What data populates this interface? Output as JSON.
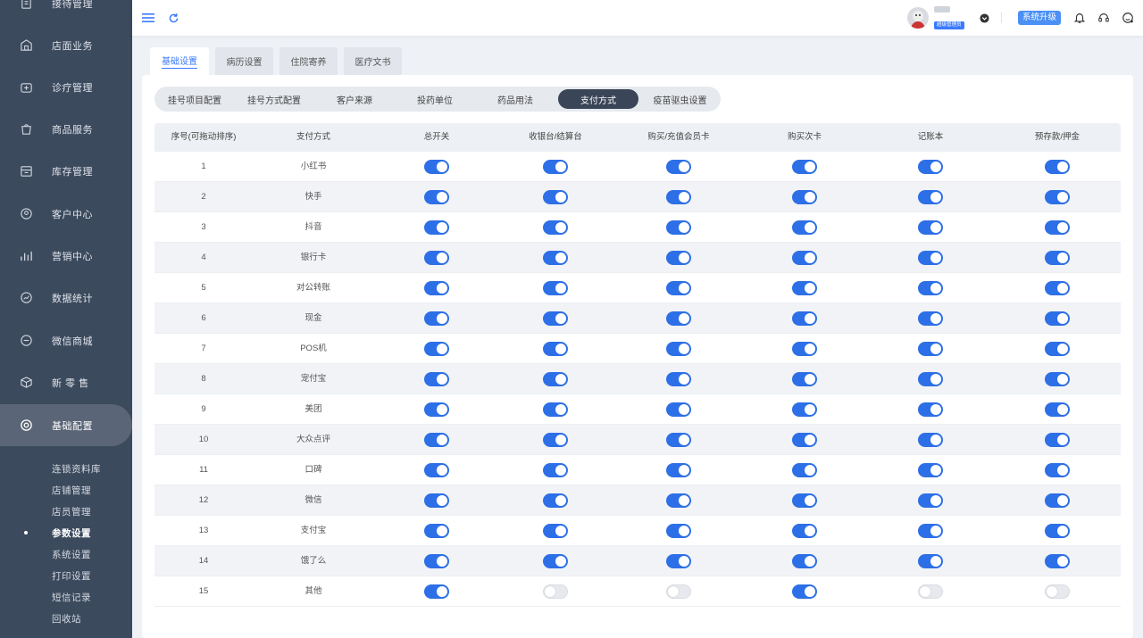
{
  "sidebar": {
    "items": [
      {
        "label": "接待管理",
        "icon": "reception-icon"
      },
      {
        "label": "店面业务",
        "icon": "store-icon"
      },
      {
        "label": "诊疗管理",
        "icon": "medical-kit-icon"
      },
      {
        "label": "商品服务",
        "icon": "shopping-bag-icon"
      },
      {
        "label": "库存管理",
        "icon": "inventory-box-icon"
      },
      {
        "label": "客户中心",
        "icon": "customer-icon"
      },
      {
        "label": "营销中心",
        "icon": "marketing-chart-icon"
      },
      {
        "label": "数据统计",
        "icon": "statistics-icon"
      },
      {
        "label": "微信商城",
        "icon": "wechat-mall-icon"
      },
      {
        "label": "新 零 售",
        "icon": "retail-cube-icon"
      },
      {
        "label": "基础配置",
        "icon": "settings-gear-icon"
      }
    ],
    "sub_items": [
      "连锁资料库",
      "店铺管理",
      "店员管理",
      "参数设置",
      "系统设置",
      "打印设置",
      "短信记录",
      "回收站"
    ],
    "current_sub": "参数设置"
  },
  "header": {
    "role_badge": "超级管理员",
    "upgrade_label": "系统升级",
    "icons": [
      "menu-icon",
      "refresh-icon",
      "bell-icon",
      "headset-icon",
      "support-icon"
    ]
  },
  "top_tabs": [
    "基础设置",
    "病历设置",
    "住院寄养",
    "医疗文书"
  ],
  "active_top_tab": "基础设置",
  "sub_tabs": [
    "挂号项目配置",
    "挂号方式配置",
    "客户来源",
    "投药单位",
    "药品用法",
    "支付方式",
    "疫苗驱虫设置"
  ],
  "active_sub_tab": "支付方式",
  "table": {
    "headers": [
      "序号(可拖动排序)",
      "支付方式",
      "总开关",
      "收银台/结算台",
      "购买/充值会员卡",
      "购买次卡",
      "记账本",
      "预存款/押金"
    ],
    "rows": [
      {
        "no": "1",
        "name": "小红书",
        "toggles": [
          true,
          true,
          true,
          true,
          true,
          true
        ]
      },
      {
        "no": "2",
        "name": "快手",
        "toggles": [
          true,
          true,
          true,
          true,
          true,
          true
        ]
      },
      {
        "no": "3",
        "name": "抖音",
        "toggles": [
          true,
          true,
          true,
          true,
          true,
          true
        ]
      },
      {
        "no": "4",
        "name": "银行卡",
        "toggles": [
          true,
          true,
          true,
          true,
          true,
          true
        ]
      },
      {
        "no": "5",
        "name": "对公转账",
        "toggles": [
          true,
          true,
          true,
          true,
          true,
          true
        ]
      },
      {
        "no": "6",
        "name": "现金",
        "toggles": [
          true,
          true,
          true,
          true,
          true,
          true
        ]
      },
      {
        "no": "7",
        "name": "POS机",
        "toggles": [
          true,
          true,
          true,
          true,
          true,
          true
        ]
      },
      {
        "no": "8",
        "name": "宠付宝",
        "toggles": [
          true,
          true,
          true,
          true,
          true,
          true
        ]
      },
      {
        "no": "9",
        "name": "美团",
        "toggles": [
          true,
          true,
          true,
          true,
          true,
          true
        ]
      },
      {
        "no": "10",
        "name": "大众点评",
        "toggles": [
          true,
          true,
          true,
          true,
          true,
          true
        ]
      },
      {
        "no": "11",
        "name": "口碑",
        "toggles": [
          true,
          true,
          true,
          true,
          true,
          true
        ]
      },
      {
        "no": "12",
        "name": "微信",
        "toggles": [
          true,
          true,
          true,
          true,
          true,
          true
        ]
      },
      {
        "no": "13",
        "name": "支付宝",
        "toggles": [
          true,
          true,
          true,
          true,
          true,
          true
        ]
      },
      {
        "no": "14",
        "name": "饿了么",
        "toggles": [
          true,
          true,
          true,
          true,
          true,
          true
        ]
      },
      {
        "no": "15",
        "name": "其他",
        "toggles": [
          true,
          false,
          false,
          true,
          false,
          false
        ]
      }
    ]
  },
  "colors": {
    "accent": "#2d6fe6",
    "sidebar": "#3c4a5d",
    "active_pill": "#3a4558"
  }
}
